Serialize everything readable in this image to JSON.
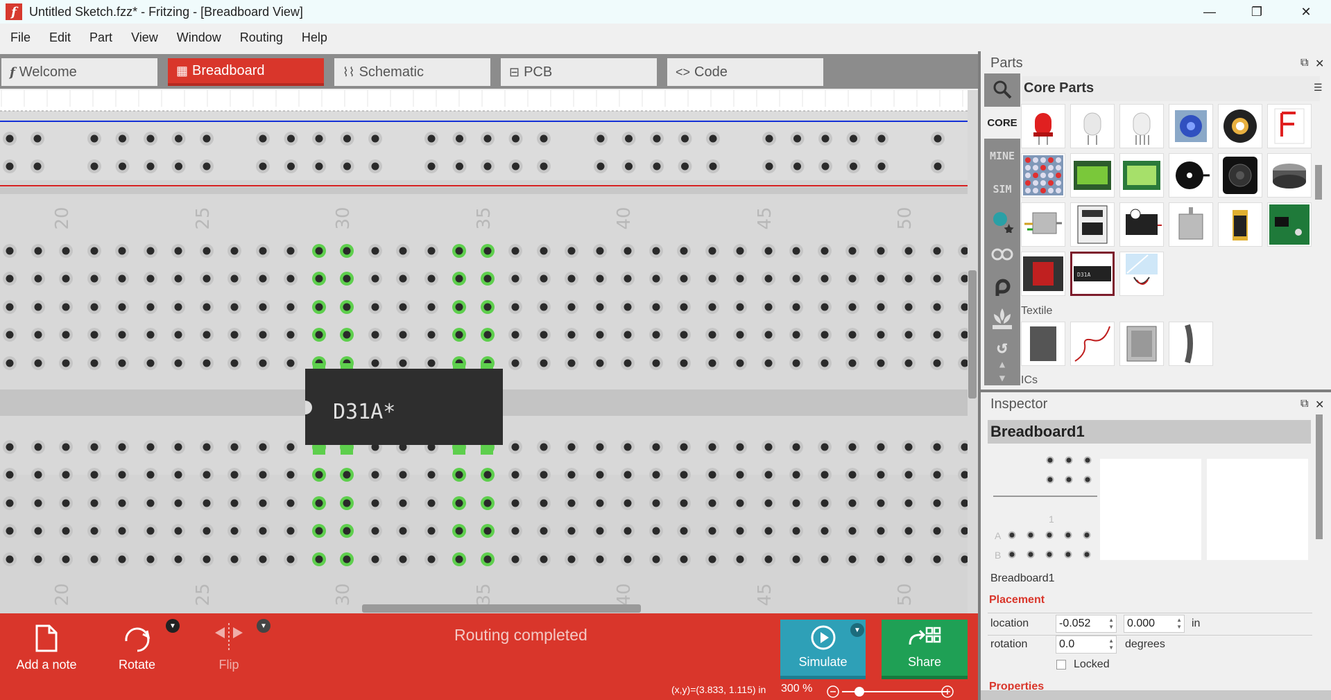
{
  "window": {
    "title": "Untitled Sketch.fzz* - Fritzing - [Breadboard View]",
    "minimize_glyph": "—",
    "maximize_glyph": "❐",
    "close_glyph": "✕",
    "logo_letter": "f"
  },
  "menu": [
    "File",
    "Edit",
    "Part",
    "View",
    "Window",
    "Routing",
    "Help"
  ],
  "tabs": [
    {
      "label": "Welcome",
      "icon": "fritzing-f-icon"
    },
    {
      "label": "Breadboard",
      "icon": "breadboard-icon",
      "active": true
    },
    {
      "label": "Schematic",
      "icon": "resistor-symbol-icon"
    },
    {
      "label": "PCB",
      "icon": "pcb-icon"
    },
    {
      "label": "Code",
      "icon": "code-brackets-icon"
    }
  ],
  "breadboard": {
    "column_labels": [
      "20",
      "25",
      "30",
      "35",
      "40",
      "45",
      "50"
    ],
    "chip_label": "D31A*",
    "accent_green": "#5ecf4d",
    "rail_blue": "#1431d6",
    "rail_red": "#d62020"
  },
  "toolbar": {
    "add_note": "Add a note",
    "rotate": "Rotate",
    "flip": "Flip",
    "status": "Routing completed",
    "simulate": "Simulate",
    "share": "Share"
  },
  "statusbar": {
    "coords": "(x,y)=(3.833, 1.115) in",
    "zoom": "300 %"
  },
  "parts_panel": {
    "title": "Parts",
    "header": "Core Parts",
    "bins": [
      "CORE",
      "MINE",
      "SIM"
    ],
    "section_textile": "Textile",
    "section_ics": "ICs"
  },
  "inspector": {
    "title": "Inspector",
    "part_title": "Breadboard1",
    "part_name": "Breadboard1",
    "preview_row_labels": [
      "A",
      "B"
    ],
    "preview_col_label": "1",
    "placement_section": "Placement",
    "location_label": "location",
    "location_x": "-0.052",
    "location_y": "0.000",
    "location_unit": "in",
    "rotation_label": "rotation",
    "rotation_value": "0.0",
    "rotation_unit": "degrees",
    "locked_label": "Locked",
    "properties_section": "Properties"
  },
  "colors": {
    "accent": "#d9362b",
    "simulate": "#2ea0b7",
    "share": "#1fa055"
  }
}
